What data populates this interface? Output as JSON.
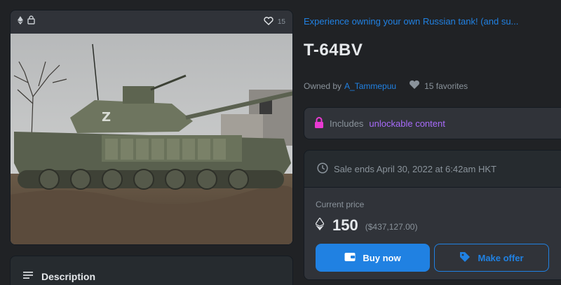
{
  "item": {
    "favorites_count": "15",
    "collection": "Experience owning your own Russian tank! (and su...",
    "title": "T-64BV",
    "owned_by_label": "Owned by",
    "owner": "A_Tammepuu",
    "favorites_text": "15 favorites",
    "description_label": "Description"
  },
  "unlockable": {
    "prefix": "Includes",
    "link": "unlockable content"
  },
  "sale": {
    "ends_text": "Sale ends April 30, 2022 at 6:42am HKT",
    "current_price_label": "Current price",
    "price": "150",
    "price_usd": "($437,127.00)"
  },
  "buttons": {
    "buy_now": "Buy now",
    "make_offer": "Make offer"
  },
  "colors": {
    "accent": "#2081e2",
    "unlock": "#a86bfa",
    "unlock_icon": "#e93ad2"
  },
  "icons": [
    "ethereum-icon",
    "lock-icon",
    "heart-icon",
    "menu-icon",
    "clock-icon",
    "wallet-icon",
    "tag-icon"
  ]
}
